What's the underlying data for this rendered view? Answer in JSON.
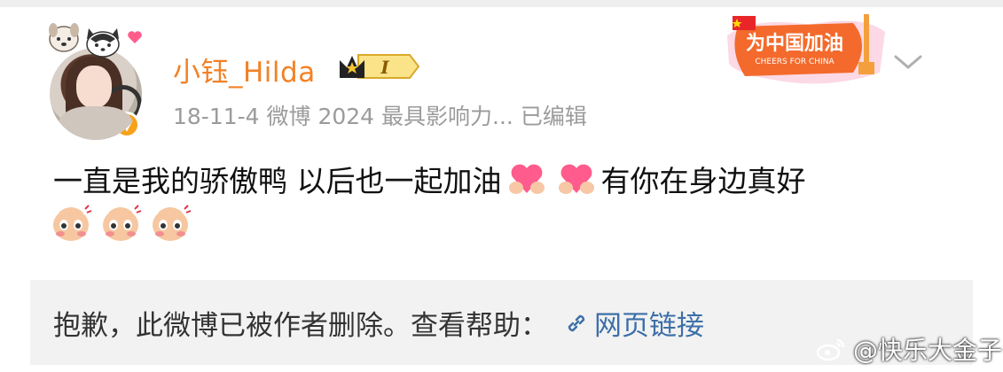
{
  "post": {
    "username": "小钰_Hilda",
    "vip_level": "I",
    "meta": "18-11-4  微博 2024 最具影响力...  已编辑",
    "text_part1": "一直是我的骄傲鸭 以后也一起加油",
    "text_part2": "有你在身边真好"
  },
  "campaign_badge": {
    "title": "为中国加油",
    "subtitle": "CHEERS FOR CHINA"
  },
  "deleted_notice": {
    "message": "抱歉，此微博已被作者删除。查看帮助：",
    "link_label": "网页链接"
  },
  "watermark": {
    "text": "@快乐大金子"
  },
  "colors": {
    "username": "#f28126",
    "meta": "#9b9b9b",
    "link": "#3d6fa8",
    "deleted_bg": "#f2f2f2",
    "verified": "#f7a21b"
  },
  "icons": [
    "dog-sticker-icon",
    "cat-sticker-icon",
    "heart-icon",
    "verified-icon",
    "vip-crown-icon",
    "chevron-down-icon",
    "heart-hands-emoji",
    "blushing-sticker",
    "link-icon",
    "weibo-logo-icon"
  ]
}
